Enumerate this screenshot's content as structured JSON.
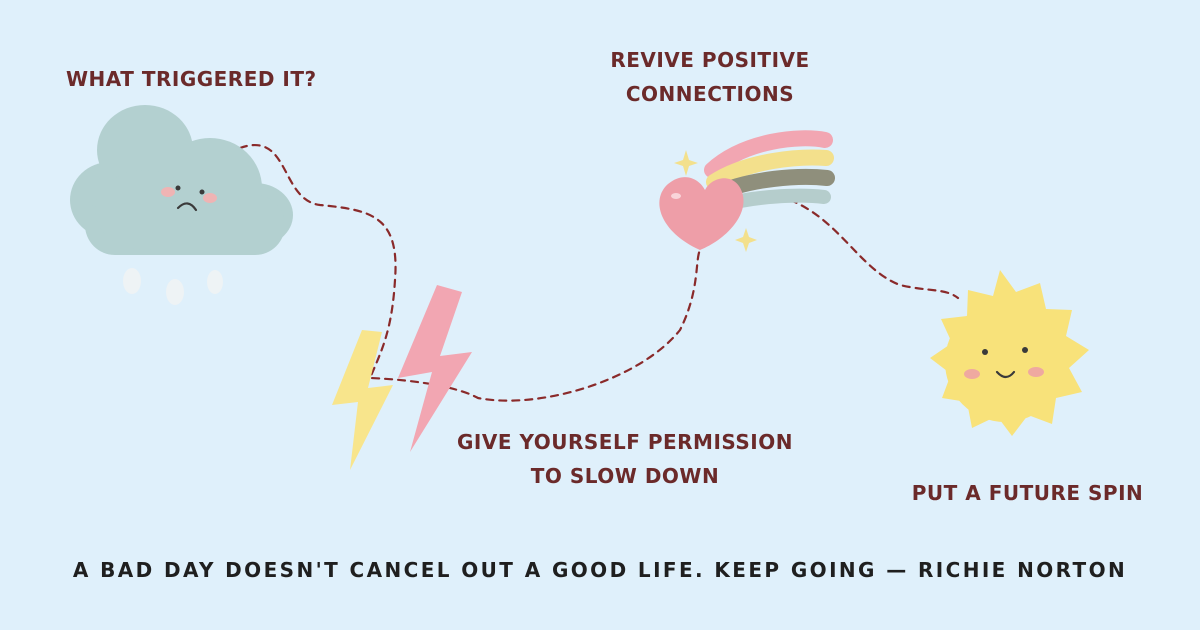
{
  "colors": {
    "background": "#dff0fb",
    "label_text": "#6b2a2a",
    "quote_text": "#1f1f1f",
    "path": "#8a2a2a",
    "cloud": "#b3d0d0",
    "bolt_yellow": "#f8e58c",
    "bolt_pink": "#f2a6b2",
    "sun": "#f8e27a",
    "heart": "#ee9ea8"
  },
  "icons": [
    "sad-cloud-icon",
    "lightning-bolt-icon",
    "rainbow-heart-icon",
    "happy-sun-icon"
  ],
  "labels": {
    "trigger": "WHAT TRIGGERED IT?",
    "revive_line1": "REVIVE POSITIVE",
    "revive_line2": "CONNECTIONS",
    "permission_line1": "GIVE YOURSELF PERMISSION",
    "permission_line2": "TO SLOW DOWN",
    "future": "PUT A FUTURE SPIN"
  },
  "quote": "A BAD DAY DOESN'T CANCEL OUT A GOOD LIFE. KEEP GOING — RICHIE NORTON"
}
